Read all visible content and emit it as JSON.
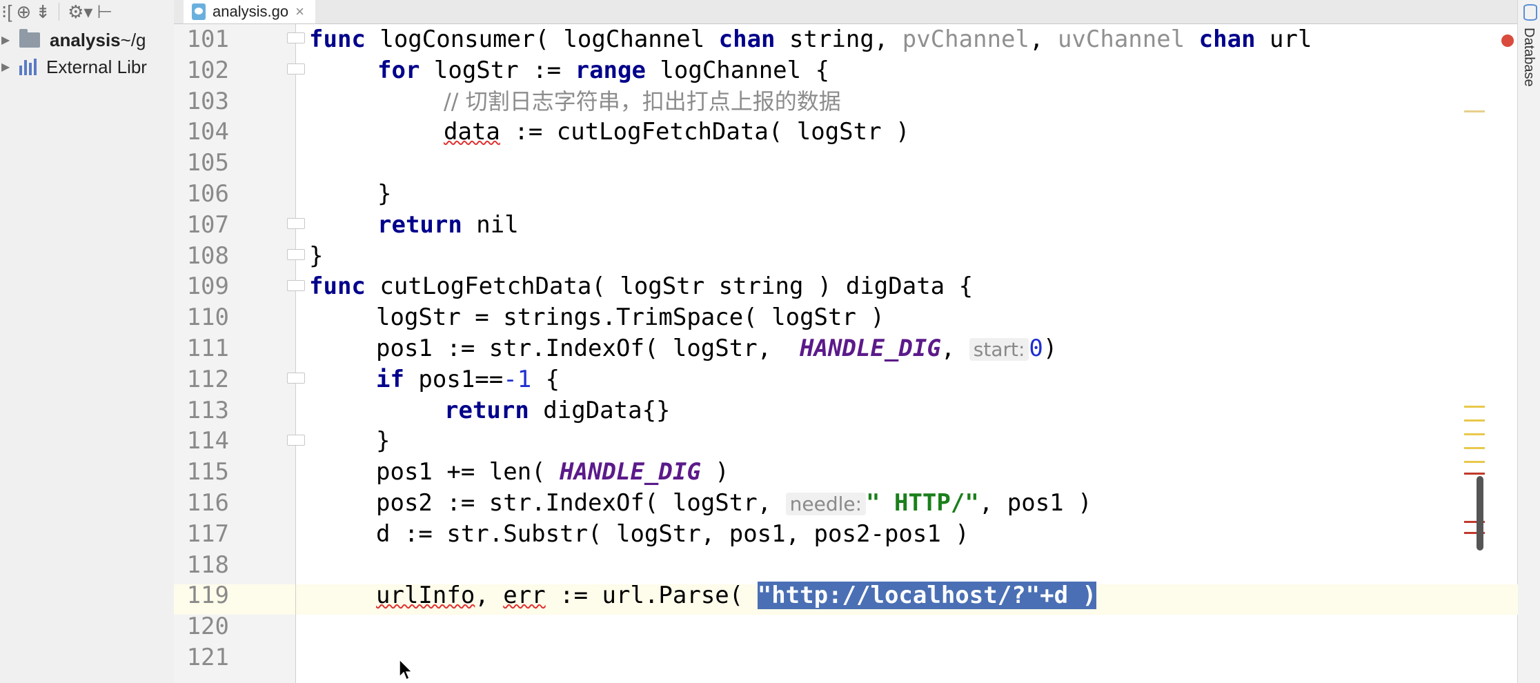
{
  "project_panel": {
    "tree": [
      {
        "label_bold": "analysis",
        "label_rest": " ~/g"
      },
      {
        "label": "External Libr"
      }
    ],
    "toolbar_icons": [
      "target-icon",
      "collapse-icon",
      "gear-icon",
      "hide-panel-icon"
    ]
  },
  "tabs": [
    {
      "label": "analysis.go",
      "close": "×"
    }
  ],
  "right_strip": {
    "label": "Database"
  },
  "editor": {
    "line_numbers": [
      "101",
      "102",
      "103",
      "104",
      "105",
      "106",
      "107",
      "108",
      "109",
      "110",
      "111",
      "112",
      "113",
      "114",
      "115",
      "116",
      "117",
      "118",
      "119",
      "120",
      "121"
    ],
    "lines": {
      "l101": {
        "func_kw": "func",
        "name": " logConsumer( logChannel ",
        "chan_kw": "chan",
        "type": " string, ",
        "pv": "pvChannel",
        "sep": ", ",
        "uv": "uvChannel",
        "sp": " ",
        "chan2": "chan",
        "tail": " url"
      },
      "l102": {
        "for_kw": "for",
        "a": " logStr := ",
        "range_kw": "range",
        "b": " logChannel {"
      },
      "l103": {
        "comment": "// 切割日志字符串，扣出打点上报的数据"
      },
      "l104": {
        "data_var": "data",
        "rest": " := cutLogFetchData( logStr )"
      },
      "l106": {
        "text": "}"
      },
      "l107": {
        "return_kw": "return",
        "rest": " nil"
      },
      "l108": {
        "text": "}"
      },
      "l109": {
        "func_kw": "func",
        "rest": " cutLogFetchData( logStr string ) digData {"
      },
      "l110": {
        "text": "logStr = strings.TrimSpace( logStr )"
      },
      "l111": {
        "a": "pos1 := str.IndexOf( logStr,  ",
        "const": "HANDLE_DIG",
        "b": ", ",
        "hint": "start:",
        "num": "0",
        "c": ")"
      },
      "l112": {
        "if_kw": "if",
        "a": " pos1==",
        "num": "-1",
        "b": " {"
      },
      "l113": {
        "return_kw": "return",
        "rest": " digData{}"
      },
      "l114": {
        "text": "}"
      },
      "l115": {
        "a": "pos1 += len( ",
        "const": "HANDLE_DIG",
        "b": " )"
      },
      "l116": {
        "a": "pos2 := str.IndexOf( logStr, ",
        "hint": "needle:",
        "str": "\" HTTP/\"",
        "b": ", pos1 )"
      },
      "l117": {
        "text": "d := str.Substr( logStr, pos1, pos2-pos1 )"
      },
      "l119": {
        "url_var": "urlInfo",
        "a": ", ",
        "err_var": "err",
        "b": " := url.Parse( ",
        "selected": "\"http://localhost/?\"+d )"
      }
    }
  },
  "colors": {
    "keyword": "#00008b",
    "constant": "#5b1a8a",
    "string": "#1a7f1a",
    "number": "#1f2fd0",
    "selection": "#4a6fb4",
    "current_line": "#fefcea"
  }
}
